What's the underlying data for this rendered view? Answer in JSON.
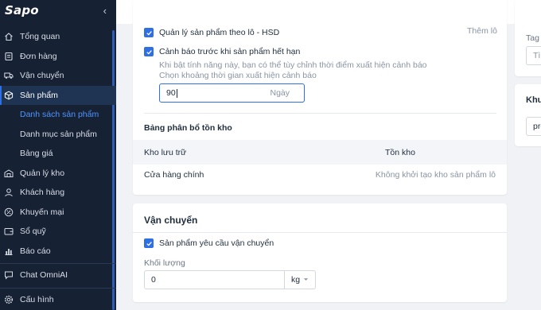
{
  "sidebar": {
    "logo": "Sapo",
    "collapse_glyph": "‹",
    "items": [
      {
        "label": "Tổng quan",
        "icon": "home-icon"
      },
      {
        "label": "Đơn hàng",
        "icon": "order-icon"
      },
      {
        "label": "Vận chuyển",
        "icon": "truck-icon"
      },
      {
        "label": "Sản phẩm",
        "icon": "box-icon"
      },
      {
        "label": "Quản lý kho",
        "icon": "warehouse-icon"
      },
      {
        "label": "Khách hàng",
        "icon": "user-icon"
      },
      {
        "label": "Khuyến mại",
        "icon": "discount-icon"
      },
      {
        "label": "Sổ quỹ",
        "icon": "wallet-icon"
      },
      {
        "label": "Báo cáo",
        "icon": "chart-icon"
      },
      {
        "label": "Chat OmniAI",
        "icon": "chat-icon"
      },
      {
        "label": "Cấu hình",
        "icon": "gear-icon"
      }
    ],
    "sub_items": [
      {
        "label": "Danh sách sản phẩm"
      },
      {
        "label": "Danh mục sản phẩm"
      },
      {
        "label": "Bảng giá"
      }
    ]
  },
  "main": {
    "batch_checkbox": "Quản lý sản phẩm theo lô - HSD",
    "add_batch_link": "Thêm lô",
    "expiry_checkbox": "Cảnh báo trước khi sản phẩm hết hạn",
    "expiry_help": "Khi bật tính năng này, bạn có thể tùy chỉnh thời điểm xuất hiện cảnh báo",
    "expiry_time_label": "Chọn khoảng thời gian xuất hiện cảnh báo",
    "expiry_value": "90",
    "expiry_unit": "Ngày",
    "stock_table_title": "Bảng phân bổ tồn kho",
    "stock_columns": [
      "Kho lưu trữ",
      "Tồn kho"
    ],
    "stock_rows": [
      {
        "warehouse": "Cửa hàng chính",
        "stock": "Không khởi tạo kho sản phẩm lô"
      }
    ],
    "shipping_title": "Vận chuyển",
    "shipping_checkbox": "Sản phẩm yêu cầu vận chuyển",
    "weight_label": "Khối lượng",
    "weight_value": "0",
    "weight_unit": "kg"
  },
  "side": {
    "tag_label": "Tag",
    "tag_placeholder": "Tìn",
    "section_title": "Khu",
    "section_value": "pro"
  },
  "colors": {
    "accent": "#2f6fe4",
    "sidebar_bg": "#162134",
    "active_link": "#4f94ff"
  }
}
